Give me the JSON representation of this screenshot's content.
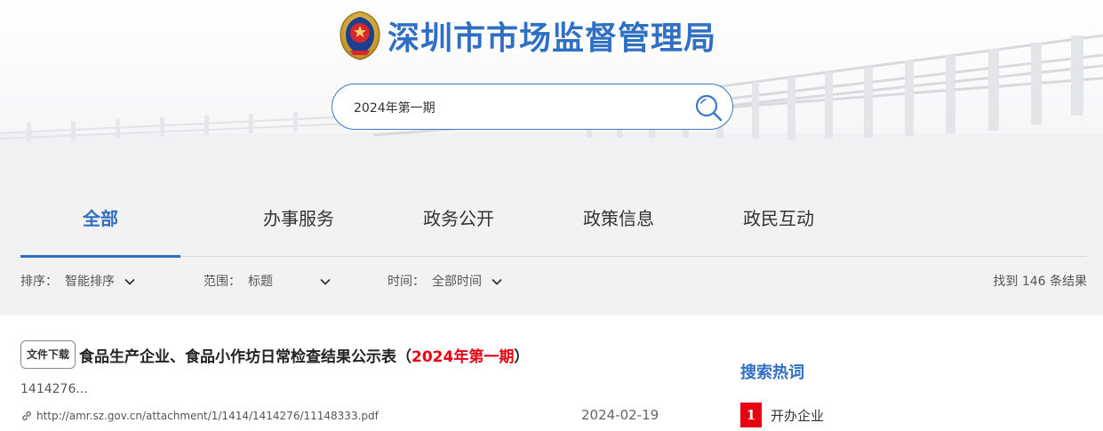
{
  "header": {
    "site_title": "深圳市市场监督管理局",
    "brand_color": "#2f6fc4"
  },
  "search": {
    "value": "2024年第一期",
    "icon": "search-icon"
  },
  "tabs": [
    {
      "label": "全部",
      "active": true
    },
    {
      "label": "办事服务",
      "active": false
    },
    {
      "label": "政务公开",
      "active": false
    },
    {
      "label": "政策信息",
      "active": false
    },
    {
      "label": "政民互动",
      "active": false
    }
  ],
  "filters": {
    "sort": {
      "label": "排序：",
      "value": "智能排序"
    },
    "scope": {
      "label": "范围：",
      "value": "标题"
    },
    "time": {
      "label": "时间：",
      "value": "全部时间"
    },
    "result_count": "找到 146 条结果"
  },
  "results": [
    {
      "badge": "文件下载",
      "title_prefix": "食品生产企业、食品小作坊日常检查结果公示表（",
      "title_highlight": "2024年第一期",
      "title_suffix": "）",
      "snippet": "1414276...",
      "url": "http://amr.sz.gov.cn/attachment/1/1414/1414276/11148333.pdf",
      "date": "2024-02-19"
    }
  ],
  "hot_words": {
    "title": "搜索热词",
    "items": [
      {
        "rank": "1",
        "word": "开办企业"
      }
    ],
    "rank_color": "#e60012"
  }
}
